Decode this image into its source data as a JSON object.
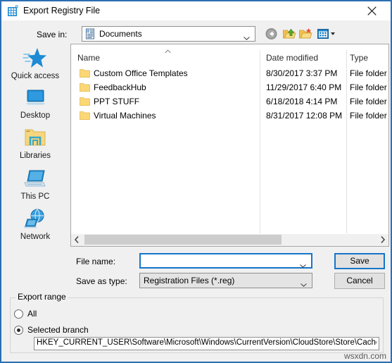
{
  "window": {
    "title": "Export Registry File",
    "icon": "registry-editor-icon",
    "close_label": "close-icon"
  },
  "toolbar": {
    "save_in_label": "Save in:",
    "location_value": "Documents",
    "location_icon": "documents-icon",
    "buttons": [
      {
        "name": "back-button",
        "icon": "back-arrow-icon"
      },
      {
        "name": "up-one-level-button",
        "icon": "up-folder-icon"
      },
      {
        "name": "create-new-folder-button",
        "icon": "new-folder-icon"
      },
      {
        "name": "views-button",
        "icon": "views-grid-icon"
      }
    ]
  },
  "places_bar": {
    "items": [
      {
        "label": "Quick access",
        "icon": "quick-access-star-icon"
      },
      {
        "label": "Desktop",
        "icon": "desktop-icon"
      },
      {
        "label": "Libraries",
        "icon": "libraries-folder-icon"
      },
      {
        "label": "This PC",
        "icon": "this-pc-monitor-icon"
      },
      {
        "label": "Network",
        "icon": "network-globe-icon"
      }
    ]
  },
  "file_list": {
    "columns": [
      "Name",
      "Date modified",
      "Type"
    ],
    "sort_indicator": "ascending",
    "rows": [
      {
        "name": "Custom Office Templates",
        "date_modified": "8/30/2017 3:37 PM",
        "type": "File folder",
        "icon": "folder-icon"
      },
      {
        "name": "FeedbackHub",
        "date_modified": "11/29/2017 6:40 PM",
        "type": "File folder",
        "icon": "folder-icon"
      },
      {
        "name": "PPT STUFF",
        "date_modified": "6/18/2018 4:14 PM",
        "type": "File folder",
        "icon": "folder-icon"
      },
      {
        "name": "Virtual Machines",
        "date_modified": "8/31/2017 12:08 PM",
        "type": "File folder",
        "icon": "folder-icon"
      }
    ]
  },
  "form": {
    "file_name_label": "File name:",
    "file_name_value": "",
    "file_name_placeholder": "",
    "save_as_type_label": "Save as type:",
    "save_as_type_value": "Registration Files (*.reg)",
    "save_button": "Save",
    "cancel_button": "Cancel"
  },
  "export_range": {
    "legend": "Export range",
    "options": [
      {
        "label": "All",
        "selected": false
      },
      {
        "label": "Selected branch",
        "selected": true
      }
    ],
    "branch_value": "HKEY_CURRENT_USER\\Software\\Microsoft\\Windows\\CurrentVersion\\CloudStore\\Store\\Cache\\Def"
  },
  "watermark": "wsxdn.com",
  "colors": {
    "accent": "#1675c9",
    "frame": "#2b6fb3",
    "dialog_bg": "#f0f0f0",
    "folder": "#fcd775"
  }
}
